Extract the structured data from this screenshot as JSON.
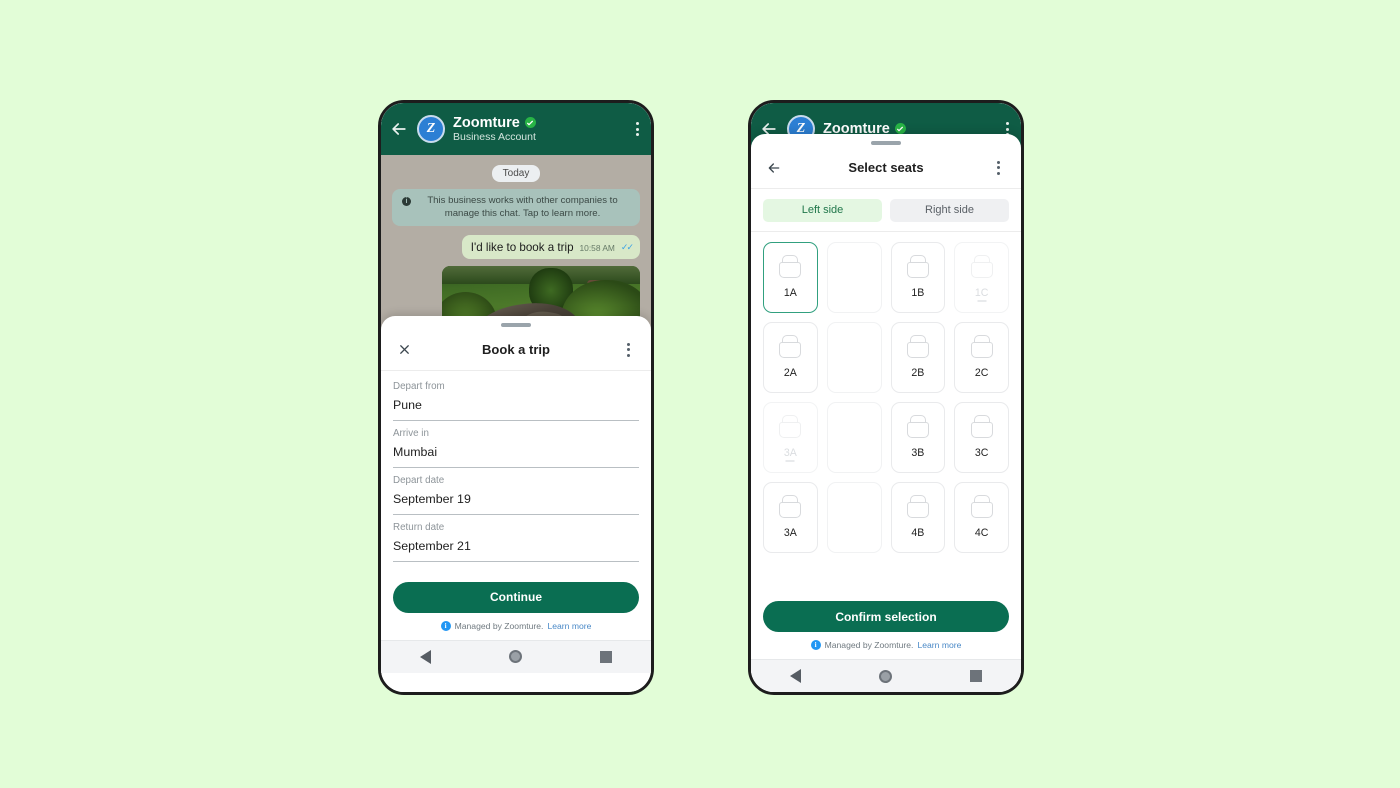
{
  "background_color": "#e2fdd7",
  "brand": {
    "header_green": "#0f5c45",
    "cta_green": "#0a6e52",
    "selected_teal": "#31a07f",
    "link_blue": "#4a89c7"
  },
  "phone_left": {
    "header": {
      "back_icon": "arrow-left-icon",
      "avatar_initial": "Z",
      "name": "Zoomture",
      "verified_icon": "verified-check-icon",
      "subtitle": "Business Account",
      "menu_icon": "kebab-menu-icon"
    },
    "chat": {
      "day_chip": "Today",
      "system_banner": "This business works with other companies to manage this chat. Tap to learn more.",
      "system_banner_icon": "info-icon",
      "message": {
        "text": "I'd like to book a trip",
        "time": "10:58 AM",
        "status_icon": "double-check-icon"
      },
      "attachment_alt": "railway-track-photo"
    },
    "sheet": {
      "close_icon": "close-icon",
      "title": "Book a trip",
      "menu_icon": "kebab-menu-icon",
      "fields": [
        {
          "label": "Depart from",
          "value": "Pune"
        },
        {
          "label": "Arrive in",
          "value": "Mumbai"
        },
        {
          "label": "Depart date",
          "value": "September 19"
        },
        {
          "label": "Return date",
          "value": "September 21"
        }
      ],
      "cta_label": "Continue",
      "footer": {
        "icon": "info-badge-icon",
        "text": "Managed by Zoomture.",
        "link": "Learn more"
      }
    },
    "navbar": {
      "back_icon": "nav-back-triangle-icon",
      "home_icon": "nav-home-circle-icon",
      "recents_icon": "nav-recents-square-icon"
    }
  },
  "phone_right": {
    "header": {
      "back_icon": "arrow-left-icon",
      "avatar_initial": "Z",
      "name": "Zoomture",
      "verified_icon": "verified-check-icon",
      "menu_icon": "kebab-menu-icon"
    },
    "sheet": {
      "back_icon": "arrow-left-icon",
      "title": "Select seats",
      "menu_icon": "kebab-menu-icon",
      "tabs": [
        {
          "label": "Left side",
          "active": true
        },
        {
          "label": "Right side",
          "active": false
        }
      ],
      "seats": [
        {
          "label": "1A",
          "state": "selected"
        },
        {
          "label": "",
          "state": "aisle"
        },
        {
          "label": "1B",
          "state": "available"
        },
        {
          "label": "1C",
          "state": "disabled"
        },
        {
          "label": "2A",
          "state": "available"
        },
        {
          "label": "",
          "state": "aisle"
        },
        {
          "label": "2B",
          "state": "available"
        },
        {
          "label": "2C",
          "state": "available"
        },
        {
          "label": "3A",
          "state": "disabled"
        },
        {
          "label": "",
          "state": "aisle"
        },
        {
          "label": "3B",
          "state": "available"
        },
        {
          "label": "3C",
          "state": "available"
        },
        {
          "label": "3A",
          "state": "available"
        },
        {
          "label": "",
          "state": "aisle"
        },
        {
          "label": "4B",
          "state": "available"
        },
        {
          "label": "4C",
          "state": "available"
        }
      ],
      "cta_label": "Confirm selection",
      "footer": {
        "icon": "info-badge-icon",
        "text": "Managed by Zoomture.",
        "link": "Learn more"
      }
    },
    "navbar": {
      "back_icon": "nav-back-triangle-icon",
      "home_icon": "nav-home-circle-icon",
      "recents_icon": "nav-recents-square-icon"
    }
  }
}
